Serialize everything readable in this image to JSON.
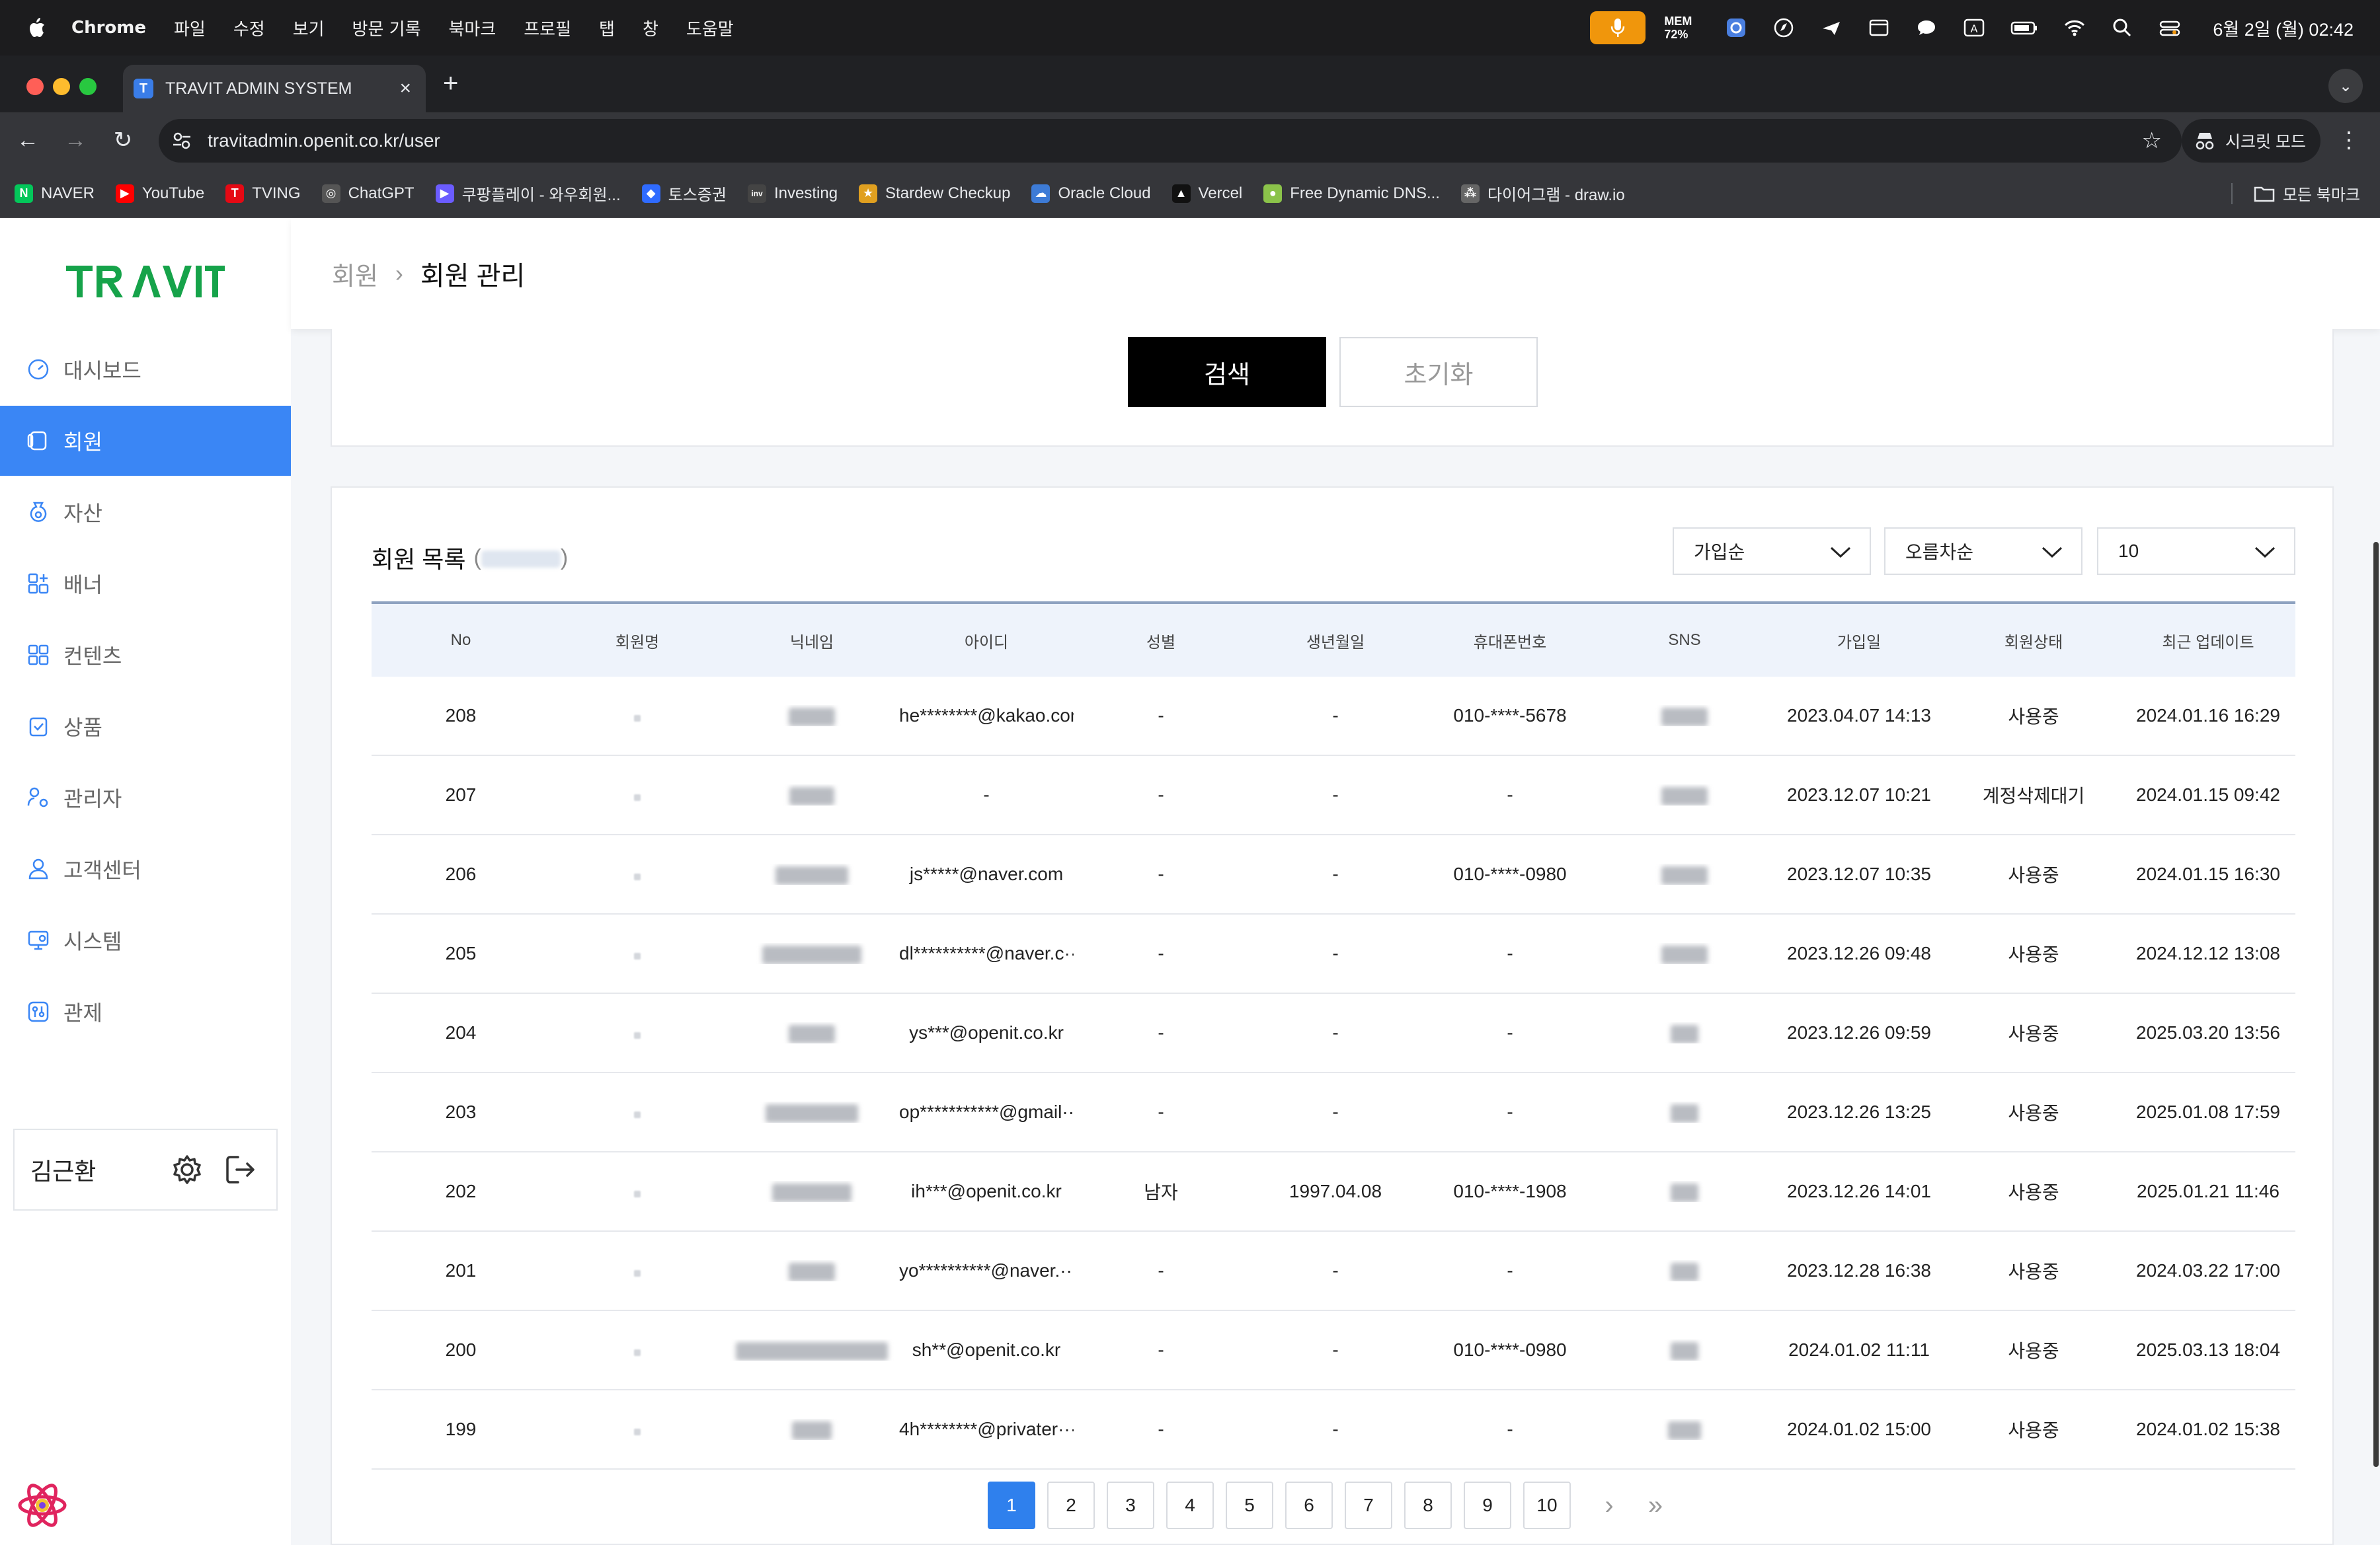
{
  "menubar": {
    "items": [
      "Chrome",
      "파일",
      "수정",
      "보기",
      "방문 기록",
      "북마크",
      "프로필",
      "탭",
      "창",
      "도움말"
    ],
    "mem_label": "MEM",
    "mem_value": "72%",
    "clock": "6월 2일 (월) 02:42"
  },
  "browser": {
    "tab_title": "TRAVIT ADMIN SYSTEM",
    "tab_favicon": "T",
    "url": "travitadmin.openit.co.kr/user",
    "incognito_label": "시크릿 모드",
    "bookmarks": [
      {
        "label": "NAVER",
        "icon": "N",
        "color": "#03c75a"
      },
      {
        "label": "YouTube",
        "icon": "▶",
        "color": "#ff0000"
      },
      {
        "label": "TVING",
        "icon": "T",
        "color": "#e50914"
      },
      {
        "label": "ChatGPT",
        "icon": "◎",
        "color": "#555555"
      },
      {
        "label": "쿠팡플레이 - 와우회원...",
        "icon": "▶",
        "color": "#6b5cff"
      },
      {
        "label": "토스증권",
        "icon": "◆",
        "color": "#2f6bff"
      },
      {
        "label": "Investing",
        "icon": "inv",
        "color": "#444444"
      },
      {
        "label": "Stardew Checkup",
        "icon": "★",
        "color": "#e0a020"
      },
      {
        "label": "Oracle Cloud",
        "icon": "☁",
        "color": "#3d7bd6"
      },
      {
        "label": "Vercel",
        "icon": "▲",
        "color": "#111111"
      },
      {
        "label": "Free Dynamic DNS...",
        "icon": "●",
        "color": "#8bc34a"
      },
      {
        "label": "다이어그램 - draw.io",
        "icon": "⁂",
        "color": "#666666"
      }
    ],
    "all_bookmarks": "모든 북마크"
  },
  "sidebar": {
    "items": [
      {
        "label": "대시보드",
        "icon": "dashboard-icon"
      },
      {
        "label": "회원",
        "icon": "member-icon",
        "active": true
      },
      {
        "label": "자산",
        "icon": "asset-icon"
      },
      {
        "label": "배너",
        "icon": "banner-icon"
      },
      {
        "label": "컨텐츠",
        "icon": "content-icon"
      },
      {
        "label": "상품",
        "icon": "product-icon"
      },
      {
        "label": "관리자",
        "icon": "admin-icon"
      },
      {
        "label": "고객센터",
        "icon": "customer-center-icon"
      },
      {
        "label": "시스템",
        "icon": "system-icon"
      },
      {
        "label": "관제",
        "icon": "monitoring-icon"
      }
    ],
    "user_name": "김근환"
  },
  "header": {
    "breadcrumb_root": "회원",
    "breadcrumb_current": "회원 관리"
  },
  "search": {
    "search_label": "검색",
    "reset_label": "초기화"
  },
  "list": {
    "title": "회원 목록",
    "sort_field": "가입순",
    "sort_order": "오름차순",
    "page_size": "10",
    "columns": [
      "No",
      "회원명",
      "닉네임",
      "아이디",
      "성별",
      "생년월일",
      "휴대폰번호",
      "SNS",
      "가입일",
      "회원상태",
      "최근 업데이트"
    ],
    "rows": [
      {
        "no": "208",
        "id": "he********@kakao.com",
        "gender": "-",
        "birth": "-",
        "phone": "010-****-5678",
        "joined": "2023.04.07 14:13",
        "status": "사용중",
        "updated": "2024.01.16 16:29"
      },
      {
        "no": "207",
        "id": "-",
        "gender": "-",
        "birth": "-",
        "phone": "-",
        "joined": "2023.12.07 10:21",
        "status": "계정삭제대기",
        "updated": "2024.01.15 09:42"
      },
      {
        "no": "206",
        "id": "js*****@naver.com",
        "gender": "-",
        "birth": "-",
        "phone": "010-****-0980",
        "joined": "2023.12.07 10:35",
        "status": "사용중",
        "updated": "2024.01.15 16:30"
      },
      {
        "no": "205",
        "id": "dl**********@naver.c···",
        "gender": "-",
        "birth": "-",
        "phone": "-",
        "joined": "2023.12.26 09:48",
        "status": "사용중",
        "updated": "2024.12.12 13:08"
      },
      {
        "no": "204",
        "id": "ys***@openit.co.kr",
        "gender": "-",
        "birth": "-",
        "phone": "-",
        "joined": "2023.12.26 09:59",
        "status": "사용중",
        "updated": "2025.03.20 13:56"
      },
      {
        "no": "203",
        "id": "op***********@gmail···",
        "gender": "-",
        "birth": "-",
        "phone": "-",
        "joined": "2023.12.26 13:25",
        "status": "사용중",
        "updated": "2025.01.08 17:59"
      },
      {
        "no": "202",
        "id": "ih***@openit.co.kr",
        "gender": "남자",
        "birth": "1997.04.08",
        "phone": "010-****-1908",
        "joined": "2023.12.26 14:01",
        "status": "사용중",
        "updated": "2025.01.21 11:46"
      },
      {
        "no": "201",
        "id": "yo**********@naver.···",
        "gender": "-",
        "birth": "-",
        "phone": "-",
        "joined": "2023.12.28 16:38",
        "status": "사용중",
        "updated": "2024.03.22 17:00"
      },
      {
        "no": "200",
        "id": "sh**@openit.co.kr",
        "gender": "-",
        "birth": "-",
        "phone": "010-****-0980",
        "joined": "2024.01.02 11:11",
        "status": "사용중",
        "updated": "2025.03.13 18:04"
      },
      {
        "no": "199",
        "id": "4h********@privater···",
        "gender": "-",
        "birth": "-",
        "phone": "-",
        "joined": "2024.01.02 15:00",
        "status": "사용중",
        "updated": "2024.01.02 15:38"
      }
    ]
  },
  "pagination": {
    "pages": [
      "1",
      "2",
      "3",
      "4",
      "5",
      "6",
      "7",
      "8",
      "9",
      "10"
    ],
    "current": "1"
  },
  "colors": {
    "accent": "#3a86f5",
    "brand_green": "#16a34a"
  }
}
